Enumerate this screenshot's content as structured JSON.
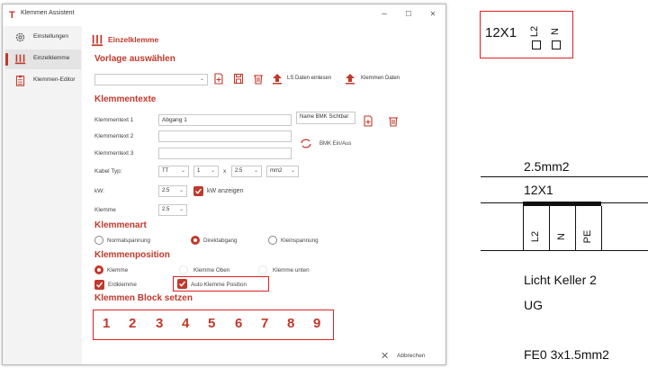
{
  "window": {
    "title": "Klemmen Assistent",
    "controls": {
      "minimize": "–",
      "maximize": "☐",
      "close": "✕"
    }
  },
  "sidebar": {
    "items": [
      {
        "label": "Einstellungen",
        "icon": "gear-icon"
      },
      {
        "label": "Einzelklemme",
        "icon": "terminal-icon",
        "active": true
      },
      {
        "label": "Klemmen-Editor",
        "icon": "clipboard-icon"
      }
    ]
  },
  "header": {
    "title": "Einzelklemme"
  },
  "vorlage": {
    "section_title": "Vorlage auswählen",
    "combo_value": "",
    "read_ls_label": "LS Daten einlesen",
    "klemmen_daten_label": "Klemmen Daten"
  },
  "klemmentexte": {
    "section_title": "Klemmentexte",
    "fields": [
      {
        "label": "Klemmentext 1",
        "value": "Abgang 1"
      },
      {
        "label": "Klemmentext 2",
        "value": ""
      },
      {
        "label": "Klemmentext 3",
        "value": ""
      }
    ],
    "bmk_field_value": "Name BMK Sichtbar",
    "bmk_toggle_label": "BMK Ein/Aus",
    "kabel_typ_label": "Kabel Typ:",
    "kabel_typ_value": "TT",
    "kabel_count_value": "1",
    "times_label": "x",
    "kabel_size_value": "2.5",
    "kabel_unit_value": "mm2",
    "kw_label": "kW:",
    "kw_value": "2.5",
    "kw_show_label": "kW anzeigen",
    "klemme_label": "Klemme",
    "klemme_value": "2.5"
  },
  "klemmenart": {
    "section_title": "Klemmenart",
    "options": [
      {
        "label": "Normalspannung",
        "checked": false
      },
      {
        "label": "Direktabgang",
        "checked": true
      },
      {
        "label": "Kleinspannung",
        "checked": false
      }
    ]
  },
  "klemmenposition": {
    "section_title": "Klemmenposition",
    "options": [
      {
        "label": "Klemme",
        "checked": true
      },
      {
        "label": "Klemme Oben",
        "checked": false
      },
      {
        "label": "Klemme unten",
        "checked": false
      }
    ],
    "erdklemme_label": "Erdklemme",
    "auto_position_label": "Auto Klemme Position"
  },
  "block": {
    "section_title": "Klemmen Block setzen",
    "numbers": [
      "1",
      "2",
      "3",
      "4",
      "5",
      "6",
      "7",
      "8",
      "9"
    ]
  },
  "footer": {
    "cancel_label": "Abbrechen"
  },
  "schematic": {
    "top_label": "12X1",
    "top_pins": [
      "L2",
      "N"
    ],
    "cable_size": "2.5mm2",
    "terminal_label": "12X1",
    "pins": [
      "L2",
      "N",
      "PE"
    ],
    "description_1": "Licht Keller 2",
    "description_2": "UG",
    "cable_label": "FE0 3x1.5mm2"
  },
  "colors": {
    "accent": "#c0392b",
    "highlight": "#e02020"
  }
}
